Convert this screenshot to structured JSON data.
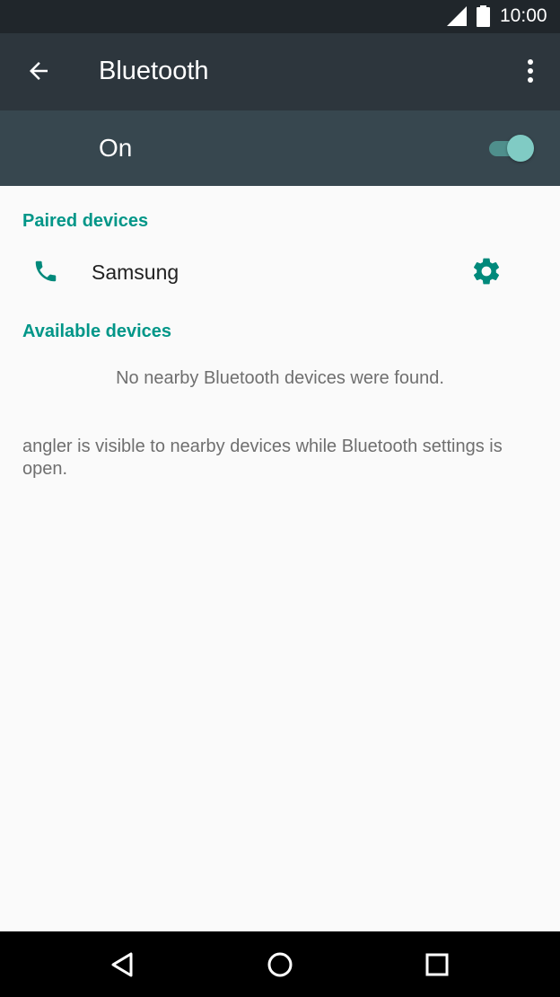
{
  "status_bar": {
    "time": "10:00",
    "icons": [
      "signal-icon",
      "battery-icon"
    ]
  },
  "app_bar": {
    "title": "Bluetooth",
    "back_icon": "arrow-back-icon",
    "menu_icon": "more-vert-icon"
  },
  "toggle": {
    "label": "On",
    "state": "on"
  },
  "paired": {
    "header": "Paired devices",
    "devices": [
      {
        "name": "Samsung",
        "icon": "phone-icon",
        "action_icon": "gear-icon"
      }
    ]
  },
  "available": {
    "header": "Available devices",
    "empty_message": "No nearby Bluetooth devices were found."
  },
  "footer": {
    "text": "angler is visible to nearby devices while Bluetooth settings is open."
  },
  "nav_bar": {
    "buttons": [
      "back-triangle-icon",
      "home-circle-icon",
      "recents-square-icon"
    ]
  },
  "colors": {
    "status_bar": "#20262b",
    "app_bar": "#2d363d",
    "toggle_bar": "#37474f",
    "accent": "#009688",
    "switch_thumb": "#80cbc4",
    "background": "#fafafa",
    "nav_bar": "#000000"
  }
}
